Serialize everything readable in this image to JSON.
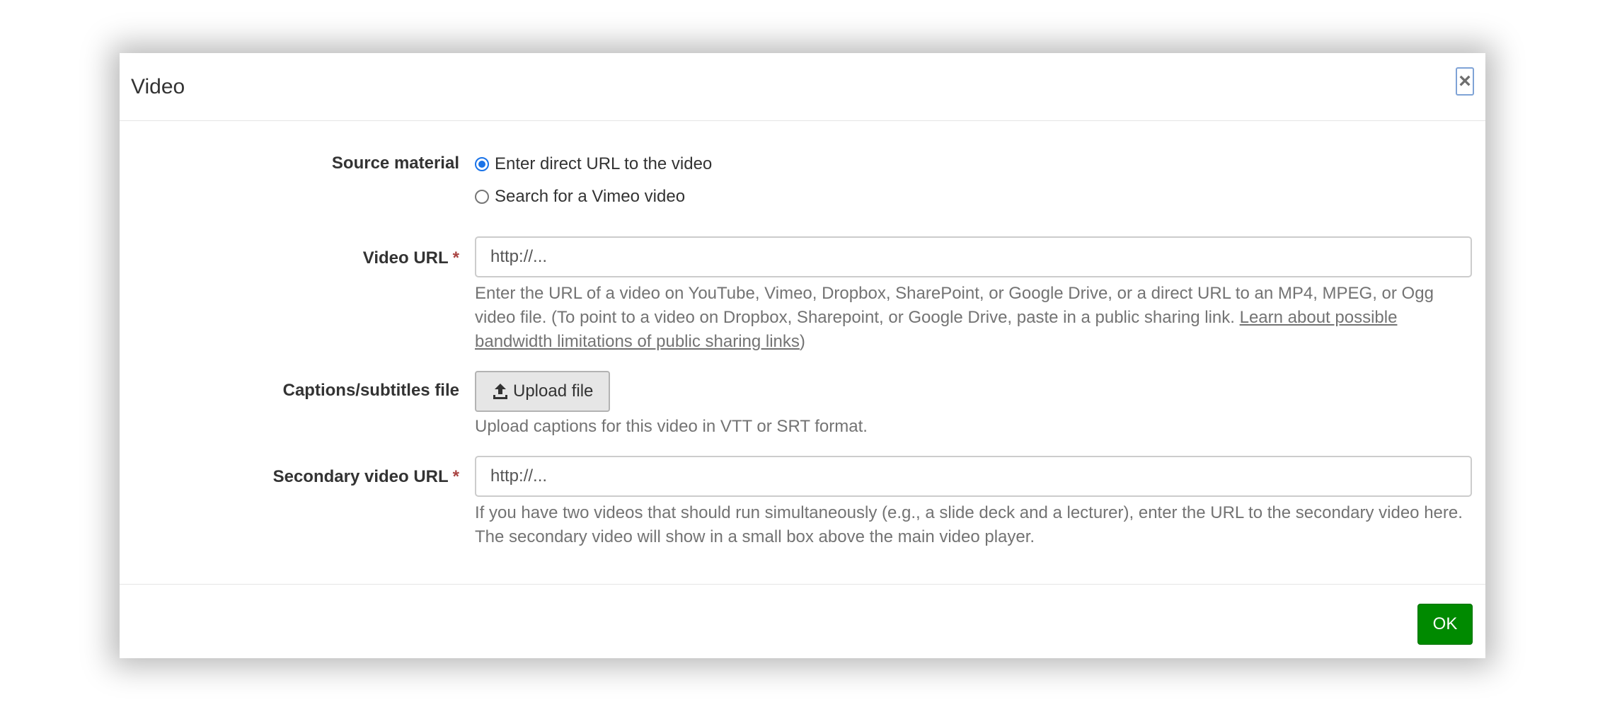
{
  "dialog": {
    "title": "Video",
    "close_label": "×"
  },
  "source_material": {
    "label": "Source material",
    "options": [
      {
        "label": "Enter direct URL to the video",
        "checked": true
      },
      {
        "label": "Search for a Vimeo video",
        "checked": false
      }
    ]
  },
  "video_url": {
    "label": "Video URL",
    "required_mark": "*",
    "placeholder": "http://...",
    "value": "",
    "help_text": "Enter the URL of a video on YouTube, Vimeo, Dropbox, SharePoint, or Google Drive, or a direct URL to an MP4, MPEG, or Ogg video file. (To point to a video on Dropbox, Sharepoint, or Google Drive, paste in a public sharing link. ",
    "help_link": "Learn about possible bandwidth limitations of public sharing links",
    "help_suffix": ")"
  },
  "captions": {
    "label": "Captions/subtitles file",
    "button_label": "Upload file",
    "help_text": "Upload captions for this video in VTT or SRT format."
  },
  "secondary_url": {
    "label": "Secondary video URL",
    "required_mark": "*",
    "placeholder": "http://...",
    "value": "",
    "help_text": "If you have two videos that should run simultaneously (e.g., a slide deck and a lecturer), enter the URL to the secondary video here. The secondary video will show in a small box above the main video player."
  },
  "footer": {
    "ok_label": "OK"
  },
  "colors": {
    "ok_button": "#008a00",
    "required": "#a94442",
    "radio_checked": "#1a73e8"
  }
}
